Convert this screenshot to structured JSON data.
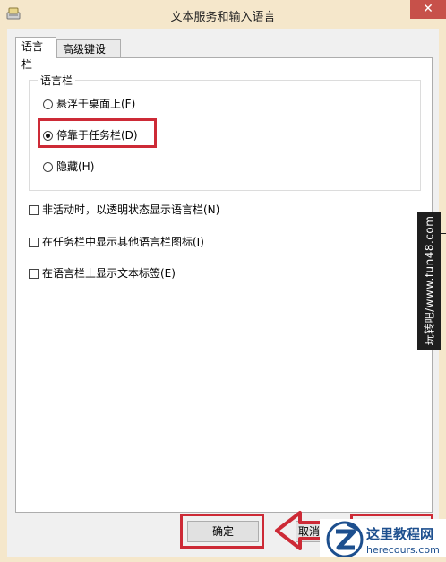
{
  "window": {
    "title": "文本服务和输入语言",
    "close_glyph": "✕"
  },
  "tabs": [
    {
      "label": "语言栏",
      "selected": true
    },
    {
      "label": "高级键设置",
      "selected": false
    }
  ],
  "langbar_group": {
    "title": "语言栏",
    "options": [
      {
        "label": "悬浮于桌面上(F)",
        "checked": false
      },
      {
        "label": "停靠于任务栏(D)",
        "checked": true
      },
      {
        "label": "隐藏(H)",
        "checked": false
      }
    ]
  },
  "checkboxes": [
    {
      "label": "非活动时，以透明状态显示语言栏(N)",
      "checked": false
    },
    {
      "label": "在任务栏中显示其他语言栏图标(I)",
      "checked": false
    },
    {
      "label": "在语言栏上显示文本标签(E)",
      "checked": false
    }
  ],
  "buttons": {
    "ok": "确定",
    "cancel": "取消"
  },
  "watermark": {
    "text": "玩转吧/www.fun48.com"
  },
  "badge": {
    "title": "这里教程网",
    "url": "herecours.com"
  },
  "colors": {
    "highlight": "#cd2a36",
    "titlebar": "#f5e7cb",
    "close_button": "#c7514a",
    "badge_text": "#1d4f8e"
  }
}
